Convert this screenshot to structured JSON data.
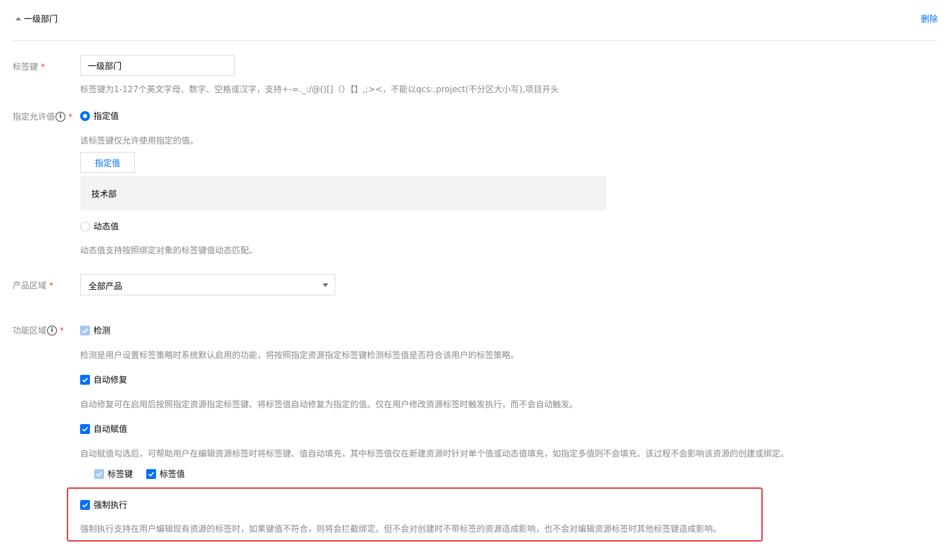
{
  "header": {
    "title": "一级部门",
    "delete_label": "删除"
  },
  "tag_key": {
    "label": "标签键",
    "required_mark": "*",
    "value": "一级部门",
    "hint": "标签键为1-127个英文字母、数字、空格或汉字，支持+-=._:/@()[]（）【】,;><，不能以qcs:,project(不分区大小写),项目开头"
  },
  "allowed_values": {
    "label": "指定允许值",
    "required_mark": "*",
    "option_specified": {
      "label": "指定值",
      "selected": true,
      "hint": "该标签键仅允许使用指定的值。",
      "button_label": "指定值",
      "values": [
        "技术部"
      ]
    },
    "option_dynamic": {
      "label": "动态值",
      "selected": false,
      "hint": "动态值支持按照绑定对象的标签键值动态匹配。"
    }
  },
  "product_scope": {
    "label": "产品区域",
    "required_mark": "*",
    "selected": "全部产品"
  },
  "function_scope": {
    "label": "功能区域",
    "required_mark": "*",
    "detect": {
      "label": "检测",
      "checked": true,
      "disabled": true,
      "hint": "检测是用户设置标签策略时系统默认启用的功能，将按照指定资源指定标签键检测标签值是否符合该用户的标签策略。"
    },
    "auto_fix": {
      "label": "自动修复",
      "checked": true,
      "hint": "自动修复可在启用后按照指定资源指定标签键、将标签值自动修复为指定的值。仅在用户修改资源标签时触发执行，而不会自动触发。"
    },
    "auto_assign": {
      "label": "自动赋值",
      "checked": true,
      "hint": "自动赋值勾选后，可帮助用户在编辑资源标签时将标签键、值自动填充，其中标签值仅在新建资源时针对单个值或动态值填充，如指定多值则不会填充。该过程不会影响该资源的创建或绑定。",
      "sub_key": {
        "label": "标签键",
        "checked": true,
        "disabled": true
      },
      "sub_value": {
        "label": "标签值",
        "checked": true
      }
    },
    "enforce": {
      "label": "强制执行",
      "checked": true,
      "hint": "强制执行支持在用户编辑现有资源的标签时，如果键值不符合，则将会拦截绑定。但不会对创建时不带标签的资源造成影响，也不会对编辑资源标签时其他标签键造成影响。"
    }
  },
  "colors": {
    "primary": "#006eff",
    "required": "#e54545",
    "hint_text": "#888888",
    "highlight_border": "#e54545"
  }
}
